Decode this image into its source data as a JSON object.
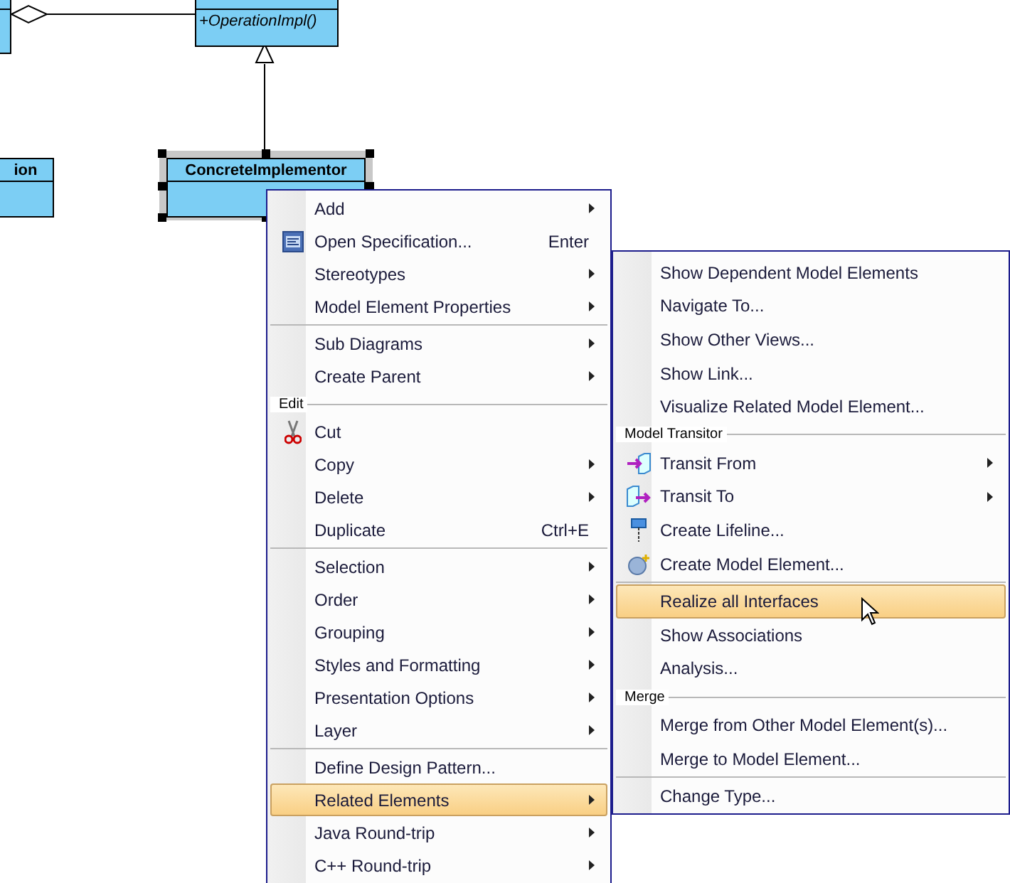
{
  "diagram": {
    "classes": [
      {
        "selected": false
      },
      {
        "abstract": true,
        "operations": [
          "+OperationImpl()"
        ],
        "selected": false
      },
      {
        "name": "ion",
        "abstract": false,
        "selected": false
      },
      {
        "name": "ConcreteImplementor",
        "abstract": false,
        "selected": true
      }
    ]
  },
  "context_menu": {
    "items": [
      {
        "kind": "item",
        "label": "Add",
        "submenu": true,
        "selected": false
      },
      {
        "kind": "item",
        "label": "Open Specification...",
        "shortcut": "Enter",
        "submenu": false,
        "selected": false
      },
      {
        "kind": "item",
        "label": "Stereotypes",
        "submenu": true,
        "selected": false
      },
      {
        "kind": "item",
        "label": "Model Element Properties",
        "submenu": true,
        "selected": false
      },
      {
        "kind": "separator"
      },
      {
        "kind": "item",
        "label": "Sub Diagrams",
        "submenu": true,
        "selected": false
      },
      {
        "kind": "item",
        "label": "Create Parent",
        "submenu": true,
        "selected": false
      },
      {
        "kind": "header",
        "label": "Edit"
      },
      {
        "kind": "item",
        "label": "Cut",
        "submenu": false,
        "selected": false
      },
      {
        "kind": "item",
        "label": "Copy",
        "submenu": true,
        "selected": false
      },
      {
        "kind": "item",
        "label": "Delete",
        "submenu": true,
        "selected": false
      },
      {
        "kind": "item",
        "label": "Duplicate",
        "shortcut": "Ctrl+E",
        "submenu": false,
        "selected": false
      },
      {
        "kind": "separator"
      },
      {
        "kind": "item",
        "label": "Selection",
        "submenu": true,
        "selected": false
      },
      {
        "kind": "item",
        "label": "Order",
        "submenu": true,
        "selected": false
      },
      {
        "kind": "item",
        "label": "Grouping",
        "submenu": true,
        "selected": false
      },
      {
        "kind": "item",
        "label": "Styles and Formatting",
        "submenu": true,
        "selected": false
      },
      {
        "kind": "item",
        "label": "Presentation Options",
        "submenu": true,
        "selected": false
      },
      {
        "kind": "item",
        "label": "Layer",
        "submenu": true,
        "selected": false
      },
      {
        "kind": "separator"
      },
      {
        "kind": "item",
        "label": "Define Design Pattern...",
        "submenu": false,
        "selected": false
      },
      {
        "kind": "item",
        "label": "Related Elements",
        "submenu": true,
        "selected": true
      },
      {
        "kind": "item",
        "label": "Java Round-trip",
        "submenu": true,
        "selected": false
      },
      {
        "kind": "item",
        "label": "C++ Round-trip",
        "submenu": true,
        "selected": false
      }
    ]
  },
  "submenu": {
    "items": [
      {
        "kind": "item",
        "label": "Show Dependent Model Elements",
        "submenu": false,
        "selected": false
      },
      {
        "kind": "item",
        "label": "Navigate To...",
        "submenu": false,
        "selected": false
      },
      {
        "kind": "item",
        "label": "Show Other Views...",
        "submenu": false,
        "selected": false
      },
      {
        "kind": "item",
        "label": "Show Link...",
        "submenu": false,
        "selected": false
      },
      {
        "kind": "item",
        "label": "Visualize Related Model Element...",
        "submenu": false,
        "selected": false
      },
      {
        "kind": "header",
        "label": "Model Transitor"
      },
      {
        "kind": "item",
        "label": "Transit From",
        "submenu": true,
        "selected": false
      },
      {
        "kind": "item",
        "label": "Transit To",
        "submenu": true,
        "selected": false
      },
      {
        "kind": "item",
        "label": "Create Lifeline...",
        "submenu": false,
        "selected": false
      },
      {
        "kind": "item",
        "label": "Create Model Element...",
        "submenu": false,
        "selected": false
      },
      {
        "kind": "separator"
      },
      {
        "kind": "item",
        "label": "Realize all Interfaces",
        "submenu": false,
        "selected": true
      },
      {
        "kind": "item",
        "label": "Show Associations",
        "submenu": false,
        "selected": false
      },
      {
        "kind": "item",
        "label": "Analysis...",
        "submenu": false,
        "selected": false
      },
      {
        "kind": "header",
        "label": "Merge"
      },
      {
        "kind": "item",
        "label": "Merge from Other Model Element(s)...",
        "submenu": false,
        "selected": false
      },
      {
        "kind": "item",
        "label": "Merge to Model Element...",
        "submenu": false,
        "selected": false
      },
      {
        "kind": "separator"
      },
      {
        "kind": "item",
        "label": "Change Type...",
        "submenu": false,
        "selected": false
      }
    ]
  }
}
